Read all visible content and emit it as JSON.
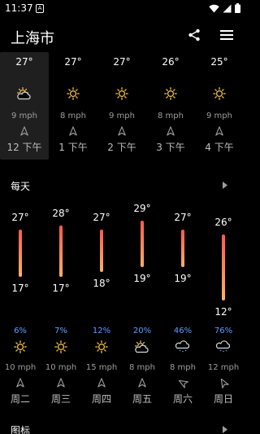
{
  "status": {
    "time": "11:37",
    "notification_glyph": "A"
  },
  "header": {
    "city": "上海市"
  },
  "hourly": [
    {
      "temp": "27°",
      "wind": "9 mph",
      "time": "12 下午",
      "icon": "partly-cloudy-icon",
      "arrow_rot": 0,
      "selected": true
    },
    {
      "temp": "27°",
      "wind": "8 mph",
      "time": "1 下午",
      "icon": "sun-icon",
      "arrow_rot": 0,
      "selected": false
    },
    {
      "temp": "27°",
      "wind": "9 mph",
      "time": "2 下午",
      "icon": "sun-icon",
      "arrow_rot": 0,
      "selected": false
    },
    {
      "temp": "26°",
      "wind": "8 mph",
      "time": "3 下午",
      "icon": "sun-icon",
      "arrow_rot": 0,
      "selected": false
    },
    {
      "temp": "25°",
      "wind": "9 mph",
      "time": "4 下午",
      "icon": "sun-icon",
      "arrow_rot": 0,
      "selected": false
    }
  ],
  "daily_section": {
    "label": "每天"
  },
  "daily": [
    {
      "day": "周二",
      "high": "27°",
      "low": "17°",
      "high_val": 27,
      "low_val": 17,
      "precip": "6%",
      "wind": "10 mph",
      "icon": "sun-icon",
      "arrow_rot": 0
    },
    {
      "day": "周三",
      "high": "28°",
      "low": "17°",
      "high_val": 28,
      "low_val": 17,
      "precip": "7%",
      "wind": "10 mph",
      "icon": "sun-icon",
      "arrow_rot": 0
    },
    {
      "day": "周四",
      "high": "27°",
      "low": "18°",
      "high_val": 27,
      "low_val": 18,
      "precip": "12%",
      "wind": "15 mph",
      "icon": "sun-icon",
      "arrow_rot": 0
    },
    {
      "day": "周五",
      "high": "29°",
      "low": "19°",
      "high_val": 29,
      "low_val": 19,
      "precip": "20%",
      "wind": "8 mph",
      "icon": "partly-cloudy-icon",
      "arrow_rot": 0
    },
    {
      "day": "周六",
      "high": "27°",
      "low": "19°",
      "high_val": 27,
      "low_val": 19,
      "precip": "46%",
      "wind": "8 mph",
      "icon": "rain-icon",
      "arrow_rot": -60
    },
    {
      "day": "周日",
      "high": "26°",
      "low": "12°",
      "high_val": 26,
      "low_val": 12,
      "precip": "76%",
      "wind": "12 mph",
      "icon": "rain-icon",
      "arrow_rot": -30
    }
  ],
  "chart_section": {
    "label": "图标"
  },
  "colors": {
    "background": "#000000",
    "precip": "#5a9fff",
    "bar_top": "#ff5a4d",
    "bar_bottom": "#ffb06a",
    "secondary_text": "#9e9e9e"
  }
}
